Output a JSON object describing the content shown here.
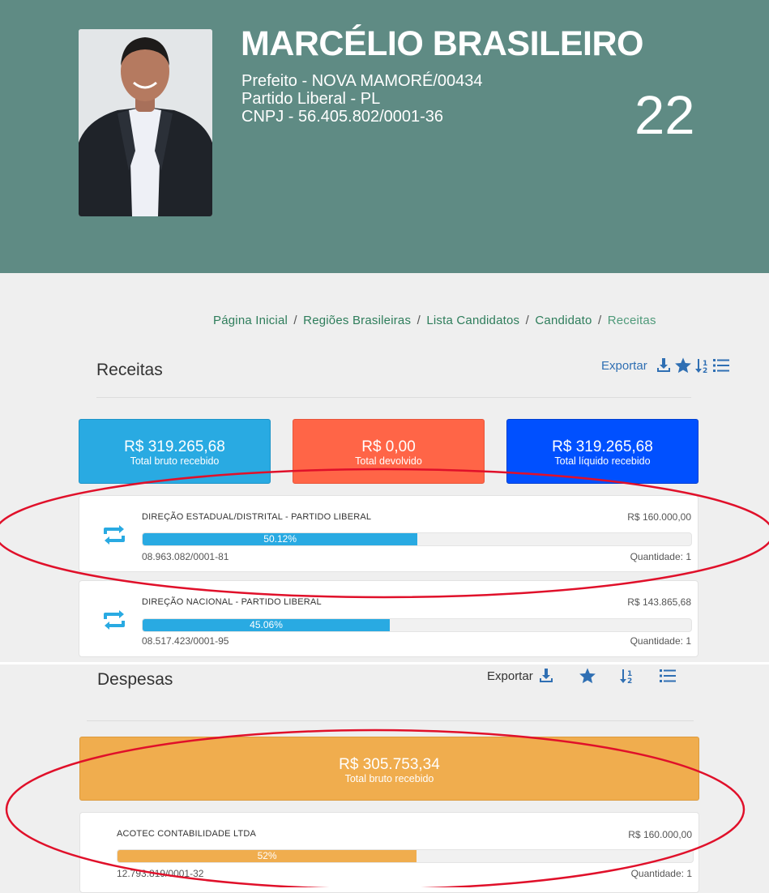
{
  "candidate": {
    "name": "MARCÉLIO BRASILEIRO",
    "role": "Prefeito - NOVA MAMORÉ/00434",
    "party": "Partido Liberal - PL",
    "cnpj": "CNPJ - 56.405.802/0001-36",
    "number": "22"
  },
  "breadcrumb": {
    "home": "Página Inicial",
    "regions": "Regiões Brasileiras",
    "list": "Lista Candidatos",
    "candidate": "Candidato",
    "current": "Receitas",
    "separator": "/"
  },
  "receitas": {
    "title": "Receitas",
    "export_label": "Exportar",
    "icons": [
      "download-icon",
      "star-icon",
      "sort-icon",
      "list-icon"
    ],
    "cards": [
      {
        "amount": "R$ 319.265,68",
        "caption": "Total bruto recebido",
        "color": "#29aae2"
      },
      {
        "amount": "R$ 0,00",
        "caption": "Total devolvido",
        "color": "#ff6547"
      },
      {
        "amount": "R$ 319.265,68",
        "caption": "Total líquido recebido",
        "color": "#0050ff"
      }
    ],
    "items": [
      {
        "name": "DIREÇÃO ESTADUAL/DISTRITAL - PARTIDO LIBERAL",
        "value": "R$ 160.000,00",
        "percent_label": "50.12%",
        "percent": 50.12,
        "doc": "08.963.082/0001-81",
        "quantity": "Quantidade: 1"
      },
      {
        "name": "DIREÇÃO NACIONAL - PARTIDO LIBERAL",
        "value": "R$ 143.865,68",
        "percent_label": "45.06%",
        "percent": 45.06,
        "doc": "08.517.423/0001-95",
        "quantity": "Quantidade: 1"
      }
    ],
    "bar_color": "#29aae2"
  },
  "despesas": {
    "title": "Despesas",
    "export_label": "Exportar",
    "card": {
      "amount": "R$ 305.753,34",
      "caption": "Total bruto recebido",
      "color": "#f0ad4e"
    },
    "items": [
      {
        "name": "ACOTEC CONTABILIDADE LTDA",
        "value": "R$ 160.000,00",
        "percent_label": "52%",
        "percent": 52,
        "doc": "12.793.819/0001-32",
        "quantity": "Quantidade: 1"
      }
    ],
    "bar_color": "#f0ad4e"
  },
  "colors": {
    "header_bg": "#5f8b84",
    "icon_blue": "#2f6fb3",
    "annotation_red": "#e0102a"
  }
}
